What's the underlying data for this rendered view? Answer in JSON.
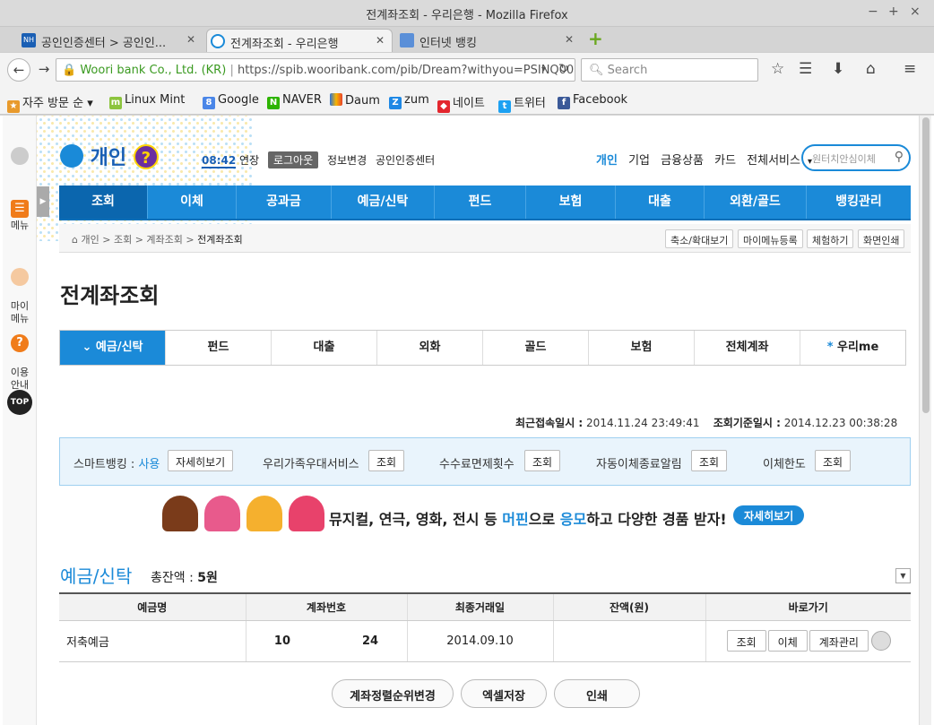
{
  "window": {
    "title": "전계좌조회 - 우리은행 - Mozilla Firefox"
  },
  "tabs": [
    {
      "label": "공인인증센터 > 공인인...",
      "icon": "nh-icon"
    },
    {
      "label": "전계좌조회 - 우리은행",
      "icon": "woori-icon"
    },
    {
      "label": "인터넷 뱅킹",
      "icon": "bank-icon"
    }
  ],
  "nav": {
    "site_identity": "Woori bank Co., Ltd. (KR)",
    "url": "https://spib.wooribank.com/pib/Dream?withyou=PSINQ001",
    "search_placeholder": "Search"
  },
  "bookmarks": [
    {
      "label": "자주 방문 순",
      "icon": "folder-icon"
    },
    {
      "label": "Linux Mint",
      "icon": "mint-icon"
    },
    {
      "label": "Google",
      "icon": "google-icon"
    },
    {
      "label": "NAVER",
      "icon": "naver-icon"
    },
    {
      "label": "Daum",
      "icon": "daum-icon"
    },
    {
      "label": "zum",
      "icon": "zum-icon"
    },
    {
      "label": "네이트",
      "icon": "nate-icon"
    },
    {
      "label": "트위터",
      "icon": "twitter-icon"
    },
    {
      "label": "Facebook",
      "icon": "facebook-icon"
    }
  ],
  "quick": {
    "menu": "메뉴",
    "my_menu": "마이\n메뉴",
    "guide": "이용\n안내",
    "top": "TOP"
  },
  "header": {
    "logo": "개인",
    "timer": "08:42",
    "extend": "연장",
    "logout": "로그아웃",
    "info_change": "정보변경",
    "cert_center": "공인인증센터",
    "links": [
      "개인",
      "기업",
      "금융상품",
      "카드",
      "전체서비스"
    ],
    "search_placeholder": "원터치안심이체"
  },
  "gnb": [
    "조회",
    "이체",
    "공과금",
    "예금/신탁",
    "펀드",
    "보험",
    "대출",
    "외환/골드",
    "뱅킹관리"
  ],
  "breadcrumb": {
    "items": [
      "개인",
      "조회",
      "계좌조회",
      "전계좌조회"
    ],
    "buttons": [
      "축소/확대보기",
      "마이메뉴등록",
      "체험하기",
      "화면인쇄"
    ]
  },
  "page_title": "전계좌조회",
  "subtabs": [
    "예금/신탁",
    "펀드",
    "대출",
    "외화",
    "골드",
    "보험",
    "전체계좌",
    "우리me"
  ],
  "access": {
    "last_label": "최근접속일시 :",
    "last_value": "2014.11.24 23:49:41",
    "base_label": "조회기준일시 :",
    "base_value": "2014.12.23 00:38:28"
  },
  "services": {
    "smart_label": "스마트뱅킹 :",
    "smart_status": "사용",
    "smart_btn": "자세히보기",
    "family_label": "우리가족우대서비스",
    "fee_label": "수수료면제횟수",
    "auto_label": "자동이체종료알림",
    "limit_label": "이체한도",
    "query_btn": "조회"
  },
  "banner": {
    "text1": "뮤지컬, 연극, 영화, 전시 등 ",
    "text2": "머핀",
    "text3": "으로 ",
    "text4": "응모",
    "text5": "하고 다양한 경품 받자!",
    "button": "자세히보기",
    "colors": [
      "#7a3b1a",
      "#e85a8c",
      "#f5b02e",
      "#e8426b"
    ]
  },
  "section": {
    "title": "예금/신탁",
    "total_label": "총잔액 :",
    "total_value": "5원"
  },
  "table": {
    "headers": [
      "예금명",
      "계좌번호",
      "최종거래일",
      "잔액(원)",
      "바로가기"
    ],
    "rows": [
      {
        "name": "저축예금",
        "acct_a": "10",
        "acct_b": "24",
        "last_date": "2014.09.10",
        "balance": "",
        "btn1": "조회",
        "btn2": "이체",
        "btn3": "계좌관리"
      }
    ]
  },
  "bottom_buttons": [
    "계좌정렬순위변경",
    "엑셀저장",
    "인쇄"
  ],
  "colors": {
    "accent": "#1b8ad8",
    "dark": "#0b66ae"
  }
}
